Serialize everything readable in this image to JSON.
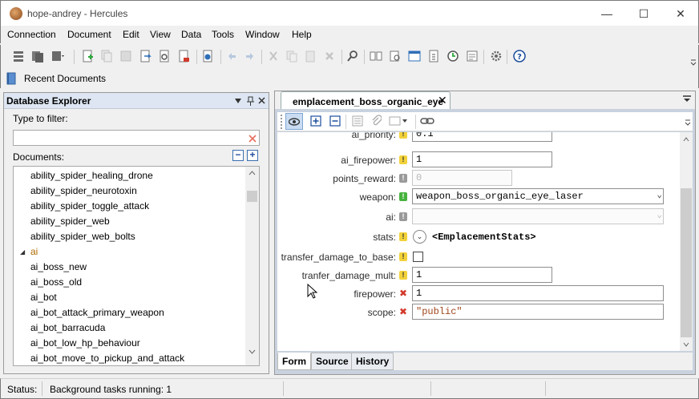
{
  "window": {
    "title": "hope-andrey - Hercules",
    "minimize_glyph": "—",
    "maximize_glyph": "☐",
    "close_glyph": "✕"
  },
  "menu": [
    "Connection",
    "Document",
    "Edit",
    "View",
    "Data",
    "Tools",
    "Window",
    "Help"
  ],
  "recent": {
    "label": "Recent Documents"
  },
  "db_explorer": {
    "title": "Database Explorer",
    "filter_label": "Type to filter:",
    "filter_value": "",
    "documents_label": "Documents:",
    "collapse_glyph": "−",
    "expand_glyph": "+",
    "folder_arrow": "◢",
    "items_before_folder": [
      "ability_spider_healing_drone",
      "ability_spider_neurotoxin",
      "ability_spider_toggle_attack",
      "ability_spider_web",
      "ability_spider_web_bolts"
    ],
    "folder": "ai",
    "items_after_folder": [
      "ai_boss_new",
      "ai_boss_old",
      "ai_bot",
      "ai_bot_attack_primary_weapon",
      "ai_bot_barracuda",
      "ai_bot_low_hp_behaviour",
      "ai_bot_move_to_pickup_and_attack"
    ]
  },
  "editor": {
    "tab_label": "emplacement_boss_organic_eye",
    "tab_close": "✕",
    "form": {
      "rows": [
        {
          "label": "ai_priority:",
          "status": "!",
          "value": "0.1"
        },
        {
          "label": "ai_firepower:",
          "status": "!",
          "value": "1"
        },
        {
          "label": "points_reward:",
          "status": "!",
          "value": "0"
        },
        {
          "label": "weapon:",
          "status": "!",
          "value": "weapon_boss_organic_eye_laser"
        },
        {
          "label": "ai:",
          "status": "!",
          "value": ""
        },
        {
          "label": "stats:",
          "status": "!",
          "value": "<EmplacementStats>"
        },
        {
          "label": "transfer_damage_to_base:",
          "status": "!",
          "value": ""
        },
        {
          "label": "tranfer_damage_mult:",
          "status": "!",
          "value": "1"
        },
        {
          "label": "firepower:",
          "status": "✖",
          "value": "1"
        },
        {
          "label": "scope:",
          "status": "✖",
          "value": "\"public\""
        }
      ],
      "expand_glyph": "⌄",
      "dropdown_glyph": "⌄"
    },
    "tabs": [
      "Form",
      "Source",
      "History"
    ],
    "active_tab": "Form"
  },
  "status": {
    "label": "Status:",
    "text": "Background tasks running: 1"
  },
  "colors": {
    "accent": "#2f6fb8",
    "tab_active": "#ffffff",
    "warn": "#f2d23a",
    "ok": "#46b23e",
    "error": "#d23a2c"
  }
}
